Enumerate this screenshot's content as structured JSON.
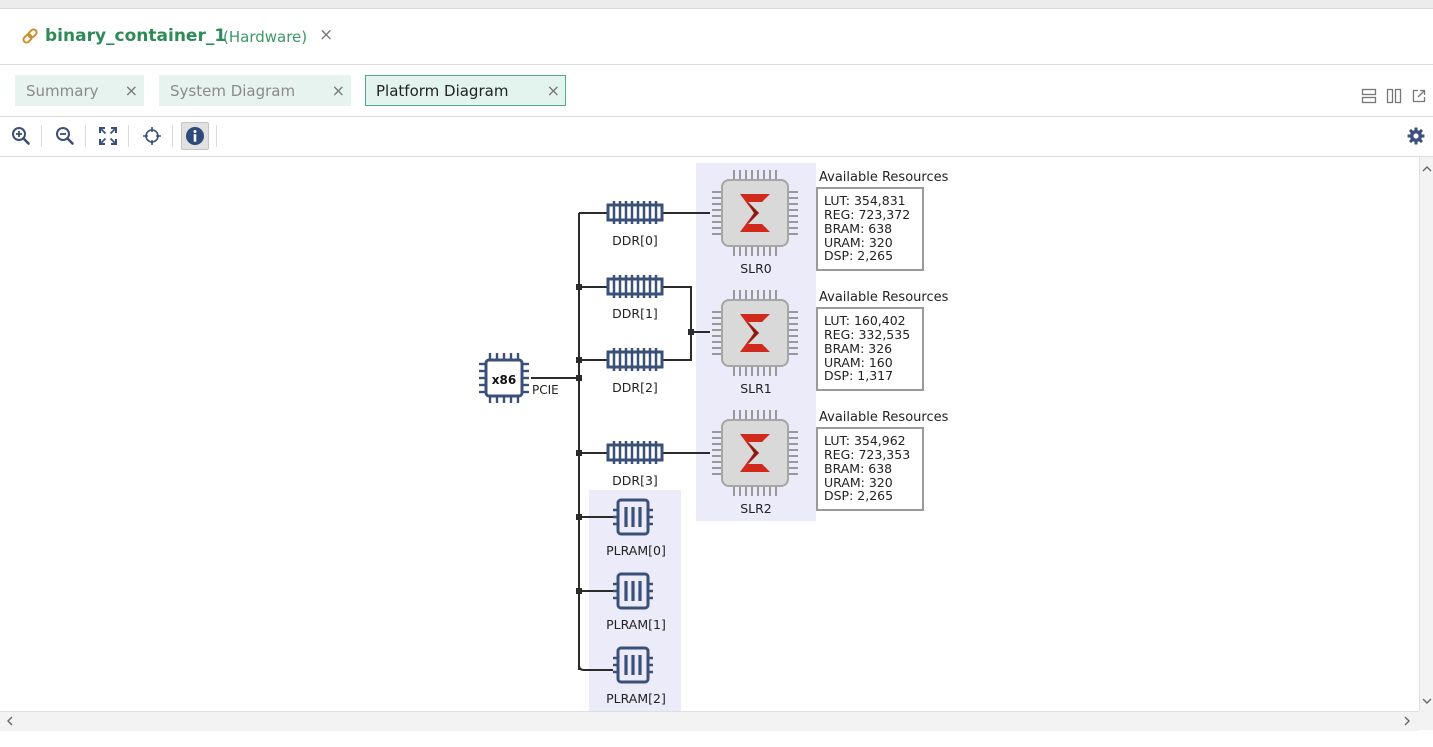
{
  "title": {
    "name": "binary_container_1",
    "kind": "(Hardware)",
    "close": "×"
  },
  "tabs": [
    {
      "label": "Summary",
      "close": "×"
    },
    {
      "label": "System Diagram",
      "close": "×"
    },
    {
      "label": "Platform Diagram",
      "close": "×"
    }
  ],
  "toolbar": {
    "buttons": [
      "zoom-in-icon",
      "zoom-out-icon",
      "fit-view-icon",
      "center-target-icon",
      "info-icon"
    ],
    "settings": "gear-icon"
  },
  "diagram": {
    "host": {
      "label": "x86",
      "port": "PCIE"
    },
    "ddr": [
      "DDR[0]",
      "DDR[1]",
      "DDR[2]",
      "DDR[3]"
    ],
    "plram": [
      "PLRAM[0]",
      "PLRAM[1]",
      "PLRAM[2]"
    ],
    "slrs": [
      {
        "name": "SLR0",
        "heading": "Available Resources",
        "resources": [
          "LUT: 354,831",
          "REG: 723,372",
          "BRAM: 638",
          "URAM: 320",
          "DSP: 2,265"
        ]
      },
      {
        "name": "SLR1",
        "heading": "Available Resources",
        "resources": [
          "LUT: 160,402",
          "REG: 332,535",
          "BRAM: 326",
          "URAM: 160",
          "DSP: 1,317"
        ]
      },
      {
        "name": "SLR2",
        "heading": "Available Resources",
        "resources": [
          "LUT: 354,962",
          "REG: 723,353",
          "BRAM: 638",
          "URAM: 320",
          "DSP: 2,265"
        ]
      }
    ]
  },
  "colors": {
    "accent": "#2e8b57",
    "tab_bg": "#e7f3ee",
    "tab_active_border": "#51a88b",
    "node_blue": "#3b5078",
    "slr_highlight": "#ebebfa",
    "chip_red": "#cf2a1c"
  }
}
